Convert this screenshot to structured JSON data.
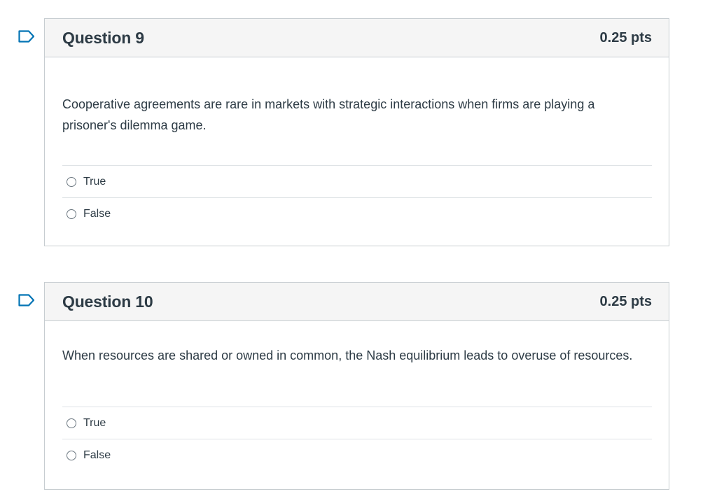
{
  "colors": {
    "flag_outline": "#0374b5",
    "header_bg": "#f5f5f5",
    "border": "#c7cdd1",
    "text": "#2d3b45"
  },
  "questions": [
    {
      "title": "Question 9",
      "points": "0.25 pts",
      "flag_icon": "bookmark-flag-icon",
      "text": "Cooperative agreements are rare in markets with strategic interactions when firms are playing a prisoner's dilemma game.",
      "answers": [
        {
          "label": "True",
          "selected": false
        },
        {
          "label": "False",
          "selected": false
        }
      ]
    },
    {
      "title": "Question 10",
      "points": "0.25 pts",
      "flag_icon": "bookmark-flag-icon",
      "text": "When resources are shared or owned in common, the Nash equilibrium leads to overuse of resources.",
      "answers": [
        {
          "label": "True",
          "selected": false
        },
        {
          "label": "False",
          "selected": false
        }
      ]
    }
  ]
}
